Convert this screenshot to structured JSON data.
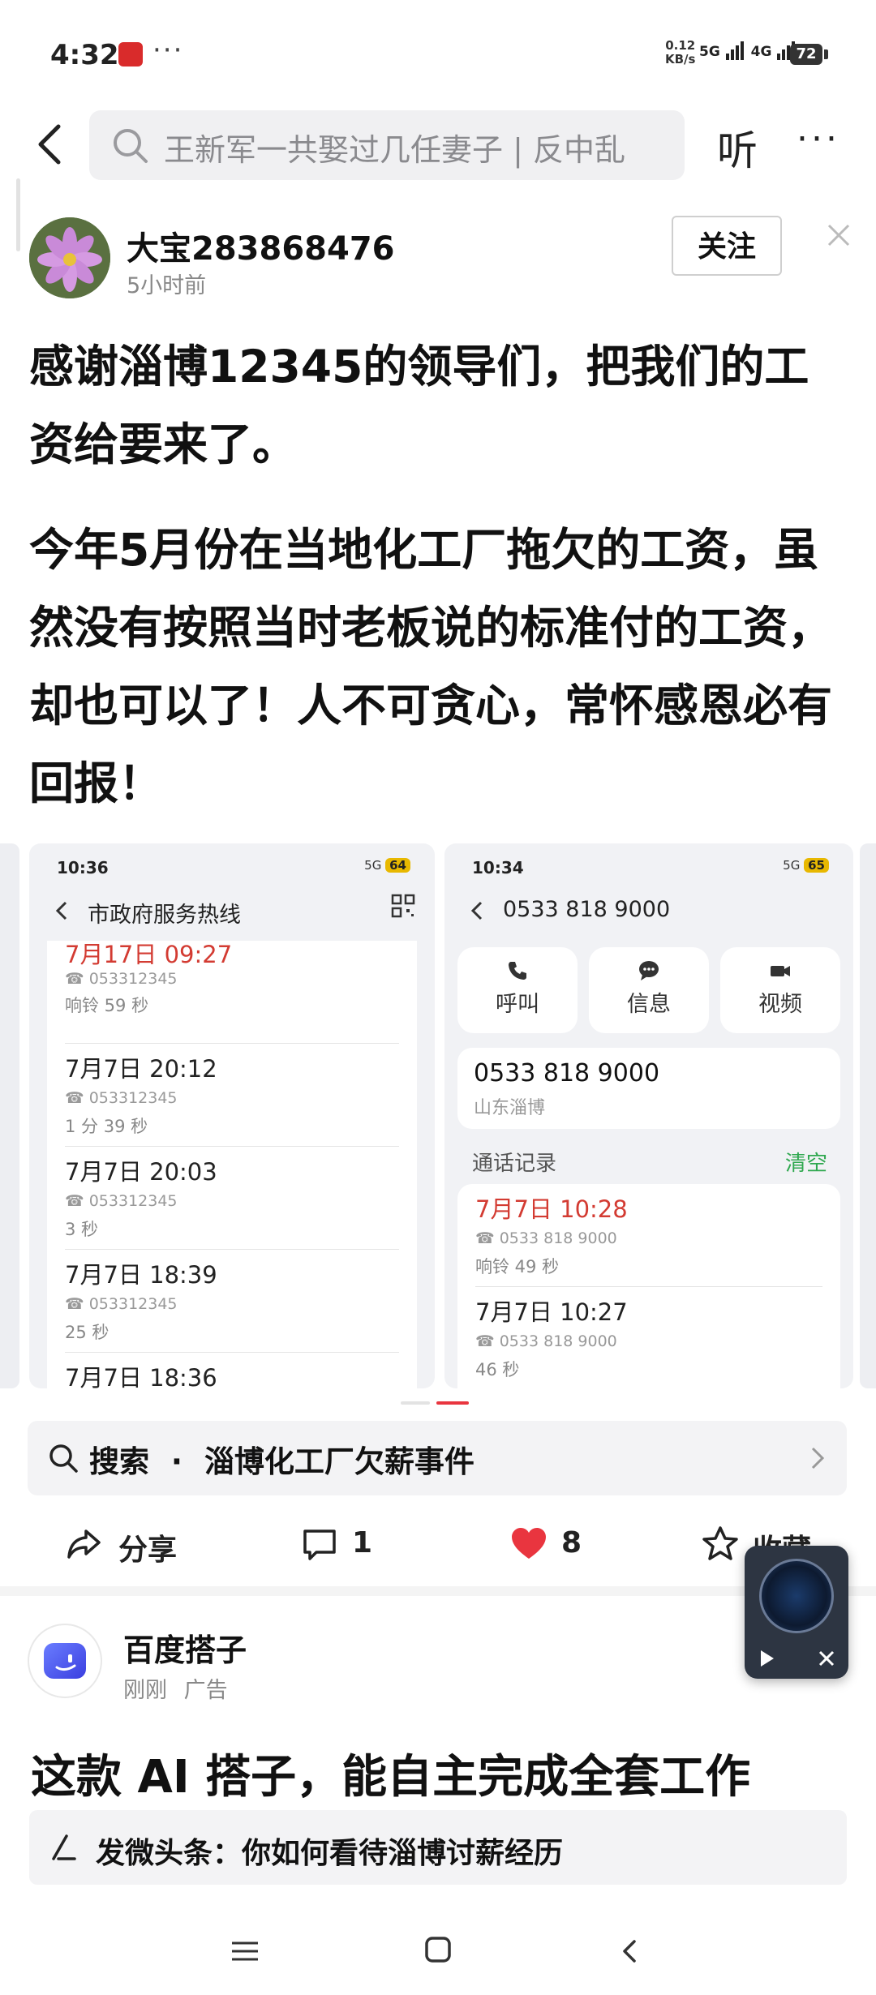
{
  "status_bar": {
    "time": "4:32",
    "app_icon": "app-notification-icon",
    "more": "···",
    "net_speed_value": "0.12",
    "net_speed_unit": "KB/s",
    "signal_a": "5G",
    "signal_b": "4G",
    "battery": "72"
  },
  "nav": {
    "search_placeholder": "王新军一共娶过几任妻子 | 反中乱",
    "listen_label": "听",
    "more_label": "···"
  },
  "author": {
    "name": "大宝283868476",
    "time": "5小时前",
    "follow_label": "关注"
  },
  "post": {
    "paragraph1": "感谢淄博12345的领导们，把我们的工资给要来了。",
    "paragraph2": "今年5月份在当地化工厂拖欠的工资，虽然没有按照当时老板说的标准付的工资，却也可以了！人不可贪心，常怀感恩必有回报！"
  },
  "screenshot_a": {
    "time": "10:36",
    "battery": "64",
    "signal": "5G",
    "title": "市政府服务热线",
    "calls": [
      {
        "time": "7月17日 09:27",
        "number": "053312345",
        "duration": "响铃 59 秒",
        "missed": true
      },
      {
        "time": "7月7日 20:12",
        "number": "053312345",
        "duration": "1 分 39 秒",
        "missed": false
      },
      {
        "time": "7月7日 20:03",
        "number": "053312345",
        "duration": "3 秒",
        "missed": false
      },
      {
        "time": "7月7日 18:39",
        "number": "053312345",
        "duration": "25 秒",
        "missed": false
      },
      {
        "time": "7月7日 18:36",
        "number": "",
        "duration": "",
        "missed": false
      }
    ]
  },
  "screenshot_b": {
    "time": "10:34",
    "battery": "65",
    "signal": "5G",
    "title": "0533 818 9000",
    "actions": [
      "呼叫",
      "信息",
      "视频"
    ],
    "number": "0533 818 9000",
    "location": "山东淄博",
    "call_log_label": "通话记录",
    "clear_label": "清空",
    "calls": [
      {
        "time": "7月7日 10:28",
        "number": "0533 818 9000",
        "duration": "响铃 49 秒",
        "missed": true
      },
      {
        "time": "7月7日 10:27",
        "number": "0533 818 9000",
        "duration": "46 秒",
        "missed": false
      }
    ]
  },
  "related_search": {
    "prefix": "搜索",
    "separator": "·",
    "query": "淄博化工厂欠薪事件"
  },
  "actions": {
    "share_label": "分享",
    "comment_count": "1",
    "like_count": "8",
    "collect_label": "收藏"
  },
  "ad": {
    "name": "百度搭子",
    "time": "刚刚",
    "tag": "广告",
    "headline": "这款 AI 搭子，能自主完成全套工作"
  },
  "comment_prompt": "发微头条：你如何看待淄博讨薪经历",
  "colors": {
    "accent_red": "#e9353f",
    "missed_call_red": "#d33b32",
    "clear_green": "#2fa84f"
  }
}
